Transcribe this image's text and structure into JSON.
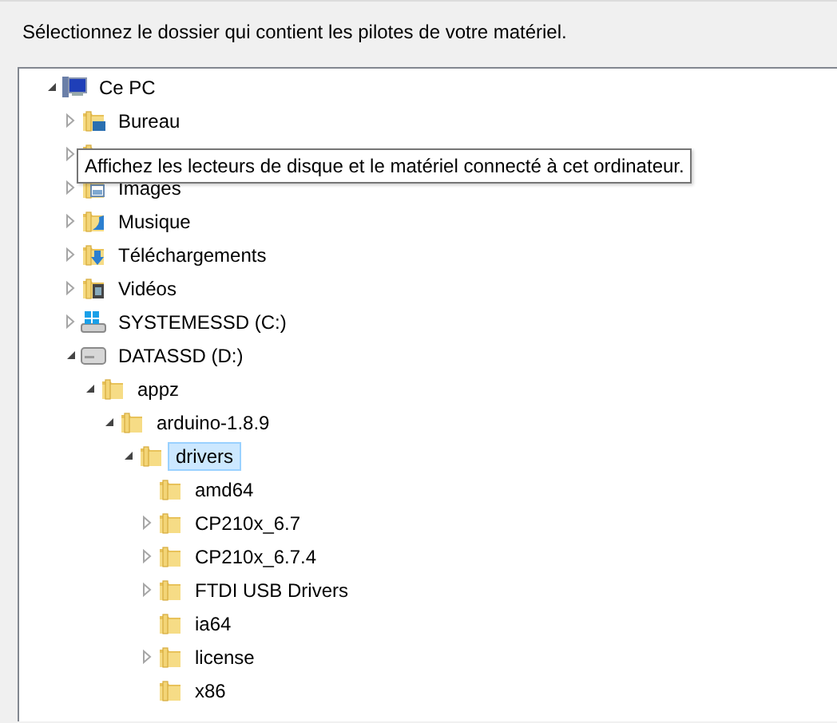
{
  "instruction": "Sélectionnez le dossier qui contient les pilotes de votre matériel.",
  "tree": [
    {
      "label": "Ce PC",
      "kind": "computer",
      "expandable": true,
      "expanded": true,
      "selected": false,
      "children": [
        {
          "label": "Bureau",
          "kind": "desktop",
          "expandable": true,
          "expanded": false,
          "selected": false
        },
        {
          "kind": "folder",
          "expandable": true,
          "expanded": false
        },
        {
          "label": "Images",
          "kind": "images",
          "expandable": true,
          "expanded": false,
          "selected": false
        },
        {
          "label": "Musique",
          "kind": "music",
          "expandable": true,
          "expanded": false,
          "selected": false
        },
        {
          "label": "Téléchargements",
          "kind": "downloads",
          "expandable": true,
          "expanded": false,
          "selected": false
        },
        {
          "label": "Vidéos",
          "kind": "videos",
          "expandable": true,
          "expanded": false,
          "selected": false
        },
        {
          "label": "SYSTEMESSD (C:)",
          "kind": "systemdrive",
          "expandable": true,
          "expanded": false,
          "selected": false
        },
        {
          "label": "DATASSD (D:)",
          "kind": "drive",
          "expandable": true,
          "expanded": true,
          "selected": false,
          "children": [
            {
              "label": "appz",
              "kind": "folder",
              "expandable": true,
              "expanded": true,
              "selected": false,
              "children": [
                {
                  "label": "arduino-1.8.9",
                  "kind": "folder",
                  "expandable": true,
                  "expanded": true,
                  "selected": false,
                  "children": [
                    {
                      "label": "drivers",
                      "kind": "folder",
                      "expandable": true,
                      "expanded": true,
                      "selected": true,
                      "children": [
                        {
                          "label": "amd64",
                          "kind": "folder",
                          "expandable": false,
                          "selected": false
                        },
                        {
                          "label": "CP210x_6.7",
                          "kind": "folder",
                          "expandable": true,
                          "expanded": false,
                          "selected": false
                        },
                        {
                          "label": "CP210x_6.7.4",
                          "kind": "folder",
                          "expandable": true,
                          "expanded": false,
                          "selected": false
                        },
                        {
                          "label": "FTDI USB Drivers",
                          "kind": "folder",
                          "expandable": true,
                          "expanded": false,
                          "selected": false
                        },
                        {
                          "label": "ia64",
                          "kind": "folder",
                          "expandable": false,
                          "selected": false
                        },
                        {
                          "label": "license",
                          "kind": "folder",
                          "expandable": true,
                          "expanded": false,
                          "selected": false
                        },
                        {
                          "label": "x86",
                          "kind": "folder",
                          "expandable": false,
                          "selected": false
                        }
                      ]
                    }
                  ]
                }
              ]
            }
          ]
        }
      ]
    }
  ],
  "tooltip": "Affichez les lecteurs de disque et le matériel connecté à cet ordinateur."
}
